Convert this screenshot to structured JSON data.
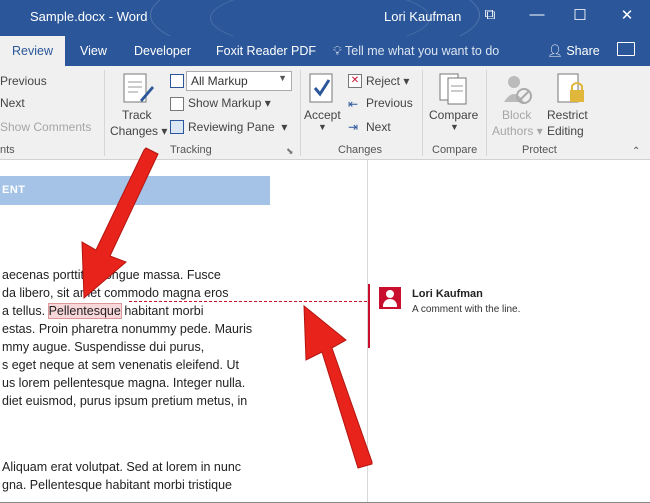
{
  "window": {
    "title": "Sample.docx - Word",
    "user": "Lori Kaufman"
  },
  "tabs": [
    {
      "label": "Review",
      "active": true
    },
    {
      "label": "View"
    },
    {
      "label": "Developer"
    },
    {
      "label": "Foxit Reader PDF"
    }
  ],
  "tell_me": "Tell me what you want to do",
  "share": "Share",
  "ribbon": {
    "comments_group": {
      "previous": "Previous",
      "next": "Next",
      "show_comments": "Show Comments",
      "label_fragment": "nts"
    },
    "tracking": {
      "track_changes_line1": "Track",
      "track_changes_line2": "Changes",
      "markup_dropdown": "All Markup",
      "show_markup": "Show Markup",
      "reviewing_pane": "Reviewing Pane",
      "label": "Tracking"
    },
    "changes": {
      "accept": "Accept",
      "reject": "Reject",
      "previous": "Previous",
      "next": "Next",
      "label": "Changes"
    },
    "compare": {
      "compare": "Compare",
      "label": "Compare"
    },
    "protect": {
      "block_line1": "Block",
      "block_line2": "Authors",
      "restrict_line1": "Restrict",
      "restrict_line2": "Editing",
      "label": "Protect"
    }
  },
  "document": {
    "heading_fragment": "ENT",
    "lines": [
      "aecenas porttitor congue massa. Fusce",
      "da libero, sit amet commodo magna eros",
      "a tellus. ",
      "estas. Proin pharetra nonummy pede. Mauris",
      "mmy augue. Suspendisse dui purus,",
      "s eget neque at sem venenatis eleifend. Ut",
      "us lorem pellentesque magna. Integer nulla.",
      "diet euismod, purus ipsum pretium metus, in"
    ],
    "highlighted_word": "Pellentesque",
    "after_highlight": " habitant morbi",
    "lines2": [
      " Aliquam erat volutpat. Sed at lorem in nunc",
      "gna. Pellentesque habitant morbi tristique"
    ]
  },
  "comment": {
    "author": "Lori Kaufman",
    "text": "A comment with the line."
  },
  "colors": {
    "accent": "#2b579a",
    "comment": "#c8102e",
    "arrow": "#e8231b"
  }
}
